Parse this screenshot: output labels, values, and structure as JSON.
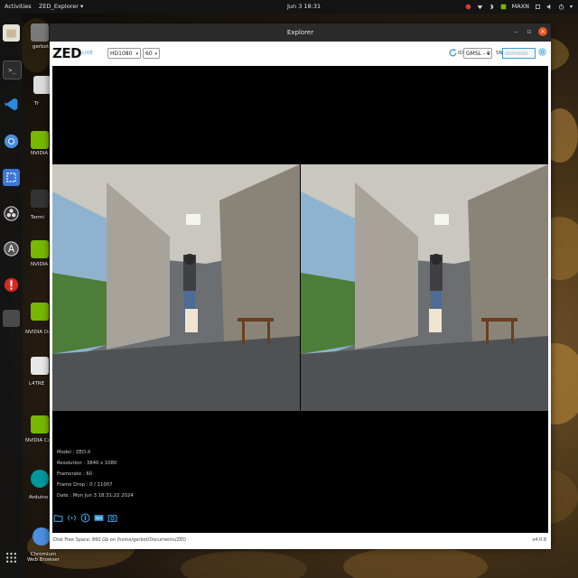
{
  "topbar": {
    "activities": "Activities",
    "app_menu": "ZED_Explorer ▾",
    "clock": "Jun 3  18:31",
    "power_mode": "MAXN"
  },
  "dock": {
    "items": [
      {
        "name": "files"
      },
      {
        "name": "terminal"
      },
      {
        "name": "vscode"
      },
      {
        "name": "chromium"
      },
      {
        "name": "screenshot"
      },
      {
        "name": "obs"
      },
      {
        "name": "arduino-a"
      },
      {
        "name": "update-red"
      },
      {
        "name": "apps-grid"
      }
    ]
  },
  "desktop": {
    "icons": [
      {
        "label": "gerbot"
      },
      {
        "label": "Tr"
      },
      {
        "label": "NVIDIA Jetson"
      },
      {
        "label": "Termi"
      },
      {
        "label": "NVIDIA Jetson S Foru"
      },
      {
        "label": "NVIDIA Develo"
      },
      {
        "label": "L4TRE"
      },
      {
        "label": "NVIDIA Commun"
      },
      {
        "label": "Arduino ID"
      },
      {
        "label": "Chromium Web Browser"
      }
    ]
  },
  "window": {
    "title": "Explorer",
    "toolbar": {
      "logo": "ZED",
      "live": "LIVE",
      "resolution": "HD1080",
      "fps": "60",
      "id_label": "ID",
      "camera_id": "GMSL - 0",
      "sn_label": "SN",
      "sn_value": "00000000"
    },
    "info": {
      "model": "Model : ZED-X",
      "resolution": "Resolution : 3840 x 1080",
      "framerate": "Framerate : 60",
      "frame_drop": "Frame Drop : 0 / 11007",
      "date": "Date : Mon Jun 3 18:31:22 2024"
    },
    "bottom": {
      "disk": "Disk Free Space: 860 Gb  on  /home/gerbot/Documents/ZED",
      "version": "v4.0.8"
    }
  },
  "colors": {
    "accent": "#3aa0d8",
    "close": "#e95420",
    "titlebar": "#2b2b2b",
    "topbar": "#141414"
  }
}
